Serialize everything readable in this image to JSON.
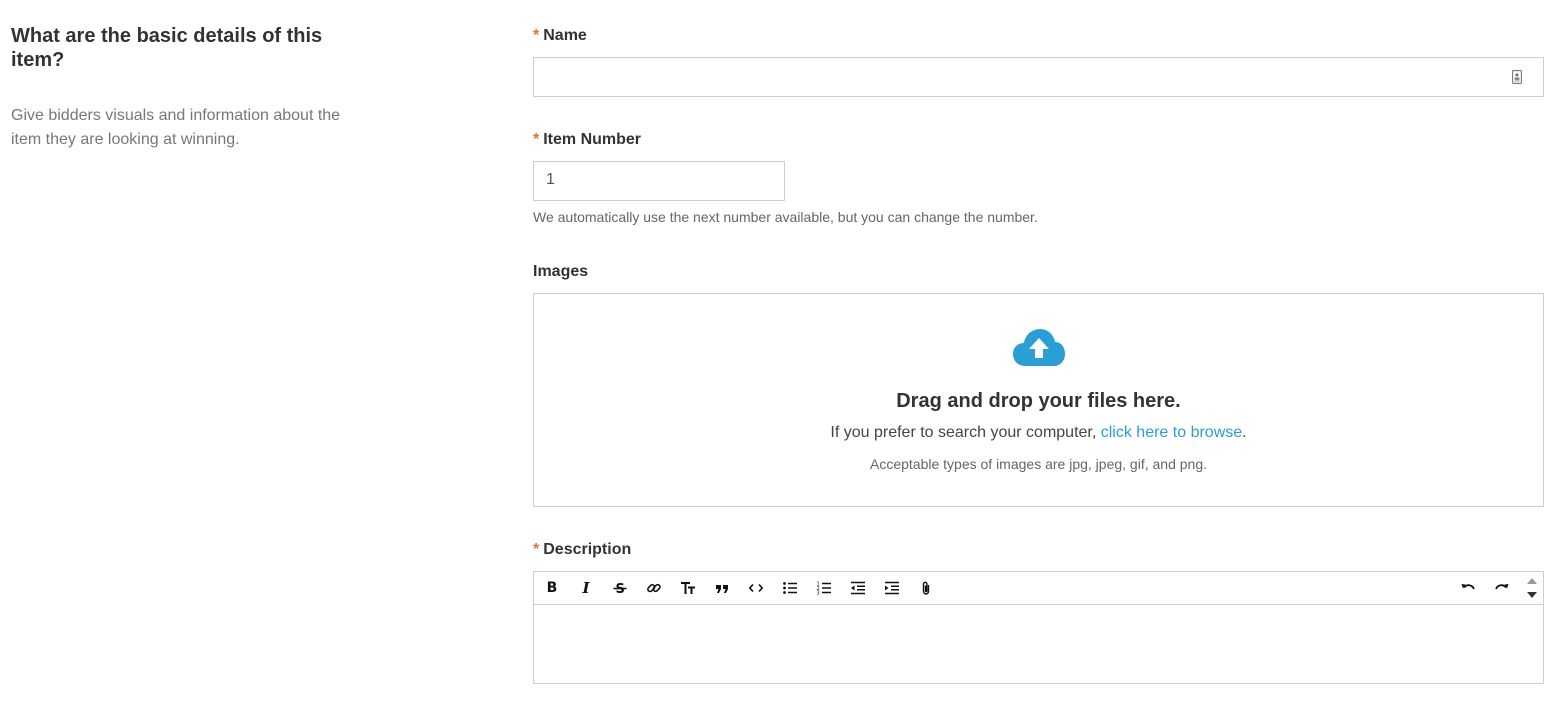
{
  "intro": {
    "title": "What are the basic details of this item?",
    "description": "Give bidders visuals and information about the item they are looking at winning."
  },
  "required_marker": "*",
  "name_field": {
    "label": "Name",
    "value": ""
  },
  "item_number_field": {
    "label": "Item Number",
    "value": "1",
    "helper": "We automatically use the next number available, but you can change the number."
  },
  "images": {
    "label": "Images",
    "drop_title": "Drag and drop your files here.",
    "prefer_text": "If you prefer to search your computer, ",
    "browse_link": "click here to browse",
    "period": ".",
    "types_note": "Acceptable types of images are jpg, jpeg, gif, and png.",
    "icon": "cloud-upload-icon",
    "accent_color": "#2a9fd6"
  },
  "description_field": {
    "label": "Description",
    "toolbar": [
      "bold",
      "italic",
      "strikethrough",
      "link",
      "heading",
      "quote",
      "code",
      "bullet-list",
      "numbered-list",
      "decrease-indent",
      "increase-indent",
      "attach",
      "undo",
      "redo"
    ],
    "value": ""
  },
  "colors": {
    "required": "#e0703a",
    "link": "#2a9fd6",
    "border": "#cfcfcf"
  }
}
